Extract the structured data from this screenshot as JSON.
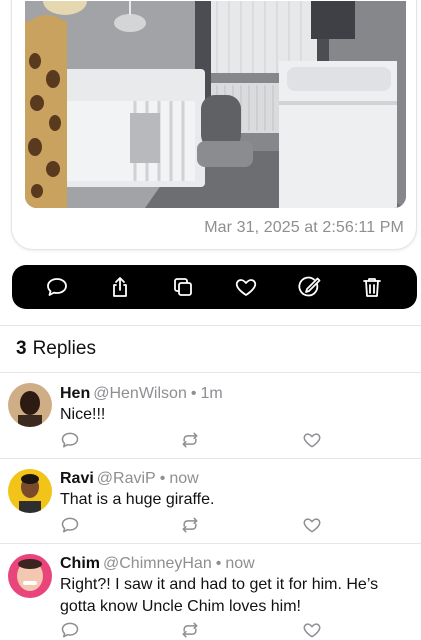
{
  "post": {
    "image_alt": "Nursery with white crib, toy giraffe, baby bouncer and changing table",
    "timestamp": "Mar 31, 2025 at 2:56:11 PM"
  },
  "action_bar": {
    "icons": [
      "reply-icon",
      "share-icon",
      "copy-icon",
      "like-icon",
      "edit-icon",
      "delete-icon"
    ]
  },
  "replies_header": {
    "count": "3",
    "label": "Replies"
  },
  "replies": [
    {
      "name": "Hen",
      "handle": "@HenWilson",
      "separator": "•",
      "time": "1m",
      "text": "Nice!!!",
      "avatar_color": "#caa27a"
    },
    {
      "name": "Ravi",
      "handle": "@RaviP",
      "separator": "•",
      "time": "now",
      "text": "That is a huge giraffe.",
      "avatar_color": "#f2c318"
    },
    {
      "name": "Chim",
      "handle": "@ChimneyHan",
      "separator": "•",
      "time": "now",
      "text": "Right?! I saw it and had to get it for him. He’s gotta know Uncle Chim loves him!",
      "avatar_color": "#e9457a"
    }
  ],
  "colors": {
    "action_bar_bg": "#000000",
    "secondary_text": "#8e8e93",
    "divider": "#e5e5ea"
  }
}
